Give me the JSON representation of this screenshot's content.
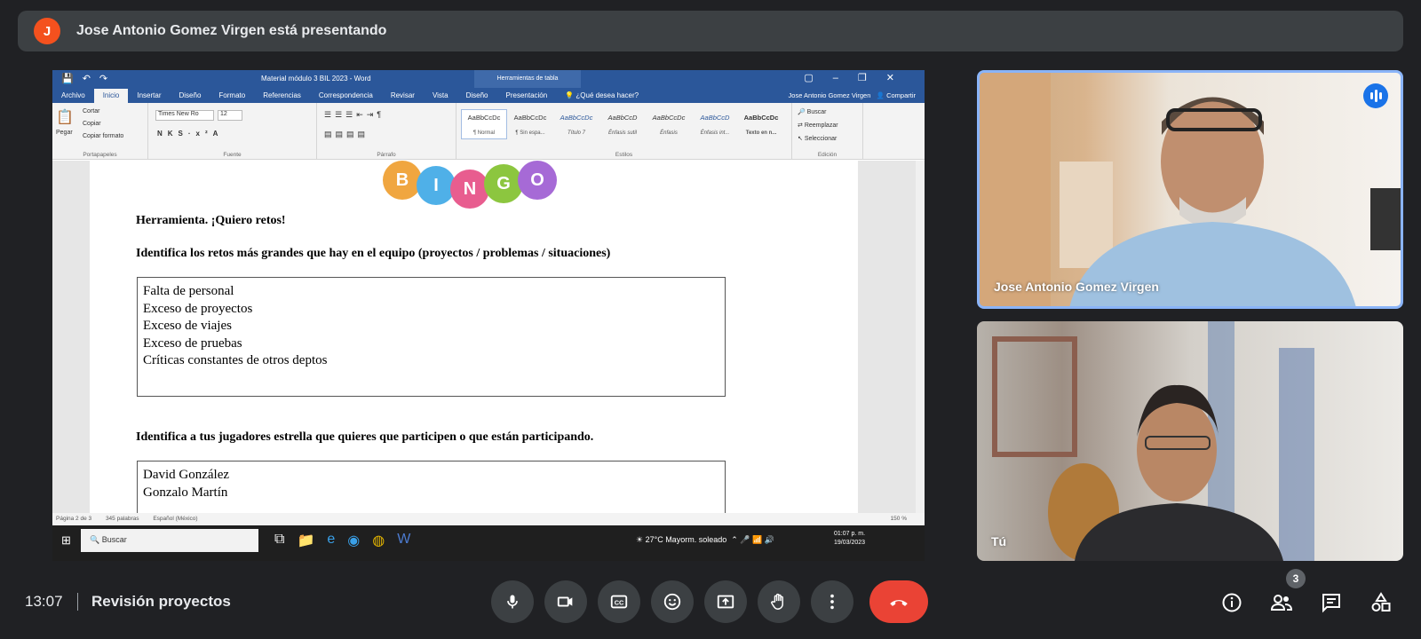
{
  "presenter": {
    "initial": "J",
    "text": "Jose Antonio Gomez Virgen está presentando",
    "avatar_color": "#f4511e"
  },
  "word": {
    "title": "Material módulo 3 BIL 2023 - Word",
    "tool_tab": "Herramientas de tabla",
    "tabs": [
      "Archivo",
      "Inicio",
      "Insertar",
      "Diseño",
      "Formato",
      "Referencias",
      "Correspondencia",
      "Revisar",
      "Vista",
      "Diseño",
      "Presentación"
    ],
    "tell_me": "¿Qué desea hacer?",
    "user": "Jose Antonio Gomez Virgen",
    "share": "Compartir",
    "clipboard": {
      "paste": "Pegar",
      "cut": "Cortar",
      "copy": "Copiar",
      "format": "Copiar formato",
      "caption": "Portapapeles"
    },
    "font": {
      "name": "Times New Ro",
      "size": "12",
      "caption": "Fuente"
    },
    "paragraph_caption": "Párrafo",
    "styles": [
      {
        "sample": "AaBbCcDc",
        "name": "¶ Normal"
      },
      {
        "sample": "AaBbCcDc",
        "name": "¶ Sin espa..."
      },
      {
        "sample": "AaBbCcDc",
        "name": "Título 7"
      },
      {
        "sample": "AaBbCcD",
        "name": "Énfasis sutil"
      },
      {
        "sample": "AaBbCcDc",
        "name": "Énfasis"
      },
      {
        "sample": "AaBbCcD",
        "name": "Énfasis int..."
      },
      {
        "sample": "AaBbCcDc",
        "name": "Texto en n..."
      }
    ],
    "styles_caption": "Estilos",
    "editing": {
      "find": "Buscar",
      "replace": "Reemplazar",
      "select": "Seleccionar",
      "caption": "Edición"
    },
    "doc": {
      "bingo_letters": [
        "B",
        "I",
        "N",
        "G",
        "O"
      ],
      "heading1": "Herramienta. ¡Quiero retos!",
      "heading2": "Identifica los retos más grandes que hay en el equipo (proyectos / problemas / situaciones)",
      "retos": [
        "Falta de personal",
        "Exceso de proyectos",
        "Exceso de viajes",
        "Exceso de pruebas",
        "Críticas constantes de otros deptos"
      ],
      "heading3": "Identifica a tus jugadores estrella que quieres que participen o que están participando.",
      "jugadores": [
        "David González",
        "Gonzalo Martín"
      ]
    },
    "status": {
      "page": "Página 2 de 3",
      "words": "345 palabras",
      "lang": "Español (México)",
      "zoom": "150 %"
    }
  },
  "taskbar": {
    "search": "Buscar",
    "weather": "27°C  Mayorm. soleado",
    "time": "01:07 p. m.",
    "date": "19/03/2023"
  },
  "participants": [
    {
      "name": "Jose Antonio Gomez Virgen"
    },
    {
      "name": "Tú"
    }
  ],
  "meeting": {
    "time": "13:07",
    "name": "Revisión proyectos",
    "people_count": "3"
  },
  "colors": {
    "bg": "#202124",
    "hangup": "#ea4335",
    "speaking": "#1a73e8",
    "word_blue": "#2b579a"
  }
}
